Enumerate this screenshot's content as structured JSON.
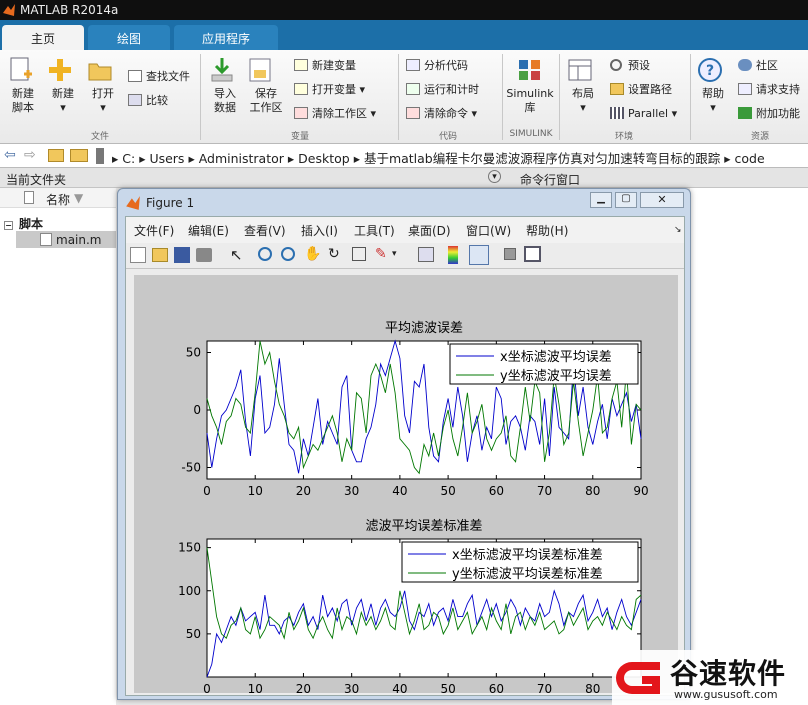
{
  "window": {
    "title": "MATLAB R2014a"
  },
  "tabs": [
    {
      "label": "主页"
    },
    {
      "label": "绘图"
    },
    {
      "label": "应用程序"
    }
  ],
  "ribbon": {
    "new_script": "新建\n脚本",
    "new": "新建",
    "open": "打开",
    "find_files": "查找文件",
    "compare": "比较",
    "import_data": "导入\n数据",
    "save_workspace": "保存\n工作区",
    "new_variable": "新建变量",
    "open_variable": "打开变量",
    "clear_workspace": "清除工作区",
    "analyze_code": "分析代码",
    "run_and_time": "运行和计时",
    "clear_commands": "清除命令",
    "simulink": "Simulink\n库",
    "layout": "布局",
    "preferences": "预设",
    "set_path": "设置路径",
    "parallel": "Parallel",
    "help": "帮助",
    "community": "社区",
    "request_support": "请求支持",
    "add_ons": "附加功能",
    "sections": {
      "file": "文件",
      "variable": "变量",
      "code": "代码",
      "simulink": "SIMULINK",
      "environment": "环境",
      "resources": "资源"
    }
  },
  "address": {
    "path": [
      "C:",
      "Users",
      "Administrator",
      "Desktop",
      "基于matlab编程卡尔曼滤波源程序仿真对匀加速转弯目标的跟踪",
      "code"
    ]
  },
  "panels": {
    "current_folder": "当前文件夹",
    "command_window": "命令行窗口",
    "name_col": "名称",
    "folder": "脚本",
    "file": "main.m"
  },
  "figure": {
    "title": "Figure 1",
    "menu": [
      "文件(F)",
      "编辑(E)",
      "查看(V)",
      "插入(I)",
      "工具(T)",
      "桌面(D)",
      "窗口(W)",
      "帮助(H)"
    ]
  },
  "chart_data": [
    {
      "type": "line",
      "title": "平均滤波误差",
      "xlim": [
        0,
        90
      ],
      "ylim": [
        -60,
        60
      ],
      "xticks": [
        0,
        10,
        20,
        30,
        40,
        50,
        60,
        70,
        80,
        90
      ],
      "yticks": [
        -50,
        0,
        50
      ],
      "legend_position": "top-right",
      "series": [
        {
          "name": "x坐标滤波平均误差",
          "color": "#0000cc",
          "values": [
            -20,
            -50,
            -25,
            -5,
            0,
            10,
            20,
            35,
            -10,
            -40,
            10,
            30,
            -20,
            -15,
            5,
            45,
            5,
            -30,
            -35,
            -55,
            -25,
            -40,
            -15,
            10,
            -30,
            -10,
            -20,
            -30,
            20,
            30,
            -35,
            -45,
            -45,
            -25,
            -15,
            5,
            40,
            30,
            45,
            65,
            45,
            -5,
            -20,
            25,
            20,
            40,
            -15,
            -40,
            -45,
            -10,
            10,
            -15,
            20,
            -5,
            -45,
            -20,
            -5,
            -35,
            -15,
            -25,
            20,
            10,
            -30,
            -10,
            -5,
            -15,
            -35,
            -5,
            -10,
            -30,
            10,
            -40,
            20,
            -15,
            -20,
            -25,
            40,
            -5,
            20,
            -15,
            -30,
            -10,
            5,
            -25,
            10,
            -5,
            5,
            15,
            -10,
            5,
            -25
          ]
        },
        {
          "name": "y坐标滤波平均误差",
          "color": "#007700",
          "values": [
            10,
            -5,
            -15,
            -30,
            -10,
            -5,
            10,
            5,
            -15,
            -20,
            15,
            60,
            40,
            50,
            25,
            5,
            -5,
            -20,
            -25,
            -15,
            -50,
            -40,
            -30,
            -35,
            -25,
            -15,
            -5,
            -20,
            -45,
            -25,
            -35,
            15,
            10,
            -20,
            30,
            40,
            30,
            15,
            40,
            15,
            -25,
            -30,
            -35,
            -50,
            -55,
            -30,
            -40,
            -20,
            -40,
            -15,
            0,
            -25,
            -40,
            -15,
            15,
            -20,
            -10,
            5,
            -25,
            -35,
            -25,
            -20,
            -5,
            -40,
            -45,
            -15,
            20,
            -10,
            25,
            15,
            -45,
            -20,
            30,
            5,
            -30,
            -20,
            25,
            -10,
            -40,
            -20,
            0,
            30,
            -20,
            -15,
            10,
            25,
            -15,
            35,
            -30,
            5,
            0
          ]
        }
      ]
    },
    {
      "type": "line",
      "title": "滤波平均误差标准差",
      "xlim": [
        0,
        90
      ],
      "ylim": [
        0,
        160
      ],
      "xticks": [
        0,
        10,
        20,
        30,
        40,
        50,
        60,
        70,
        80
      ],
      "yticks": [
        50,
        100,
        150
      ],
      "legend_position": "top-right",
      "series": [
        {
          "name": "x坐标滤波平均误差标准差",
          "color": "#0000cc",
          "values": [
            0,
            15,
            50,
            40,
            55,
            70,
            60,
            80,
            65,
            70,
            75,
            55,
            95,
            60,
            60,
            50,
            65,
            70,
            60,
            75,
            85,
            60,
            70,
            55,
            95,
            70,
            80,
            65,
            85,
            90,
            60,
            80,
            90,
            65,
            85,
            60,
            80,
            90,
            75,
            70,
            80,
            100,
            65,
            55,
            75,
            70,
            85,
            60,
            75,
            80,
            65,
            90,
            70,
            70,
            85,
            95,
            60,
            75,
            90,
            70,
            85,
            65,
            75,
            90,
            80,
            60,
            80,
            70,
            65,
            85,
            70,
            75,
            100,
            85,
            60,
            75,
            70,
            85,
            95,
            65,
            75,
            90,
            70,
            80,
            55,
            75,
            90,
            70,
            60,
            75,
            90
          ]
        },
        {
          "name": "y坐标滤波平均误差标准差",
          "color": "#007700",
          "values": [
            150,
            110,
            70,
            50,
            45,
            60,
            65,
            80,
            55,
            50,
            70,
            45,
            55,
            70,
            65,
            60,
            45,
            75,
            55,
            65,
            80,
            55,
            45,
            60,
            70,
            55,
            45,
            80,
            55,
            70,
            65,
            50,
            75,
            60,
            70,
            55,
            65,
            80,
            60,
            55,
            100,
            75,
            50,
            65,
            85,
            55,
            60,
            75,
            70,
            50,
            60,
            80,
            55,
            65,
            75,
            50,
            60,
            70,
            55,
            80,
            65,
            55,
            85,
            50,
            70,
            75,
            55,
            70,
            60,
            75,
            55,
            60,
            65,
            50,
            55,
            75,
            60,
            70,
            80,
            55,
            65,
            70,
            60,
            75,
            65,
            55,
            70,
            60,
            55,
            90,
            95
          ]
        }
      ]
    }
  ],
  "watermark": {
    "brand": "谷速软件",
    "url": "www.gususoft.com"
  }
}
